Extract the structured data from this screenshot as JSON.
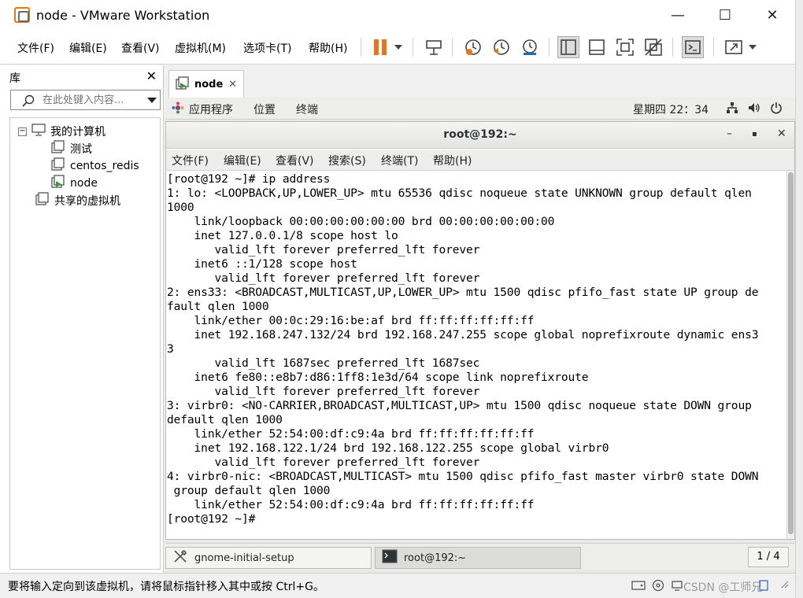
{
  "window": {
    "title": "node - VMware Workstation",
    "minimize": "—",
    "maximize": "☐",
    "close": "✕"
  },
  "host_menu": [
    {
      "label": "文件(F)"
    },
    {
      "label": "编辑(E)"
    },
    {
      "label": "查看(V)"
    },
    {
      "label": "虚拟机(M)"
    },
    {
      "label": "选项卡(T)"
    },
    {
      "label": "帮助(H)"
    }
  ],
  "toolbar_icons": [
    "pause-icon",
    "dropdown-icon",
    "send-ctrl-alt-del-icon",
    "snapshot-icon",
    "revert-snapshot-icon",
    "snapshot-manager-icon",
    "library-view-icon",
    "thumbnail-view-icon",
    "fullscreen-icon",
    "unity-icon",
    "console-view-icon",
    "stretch-icon"
  ],
  "library": {
    "title": "库",
    "close": "✕",
    "search_placeholder": "在此处键入内容...",
    "tree": {
      "my_computer": "我的计算机",
      "vms": [
        "测试",
        "centos_redis",
        "node"
      ],
      "shared": "共享的虚拟机",
      "collapse": "−"
    }
  },
  "tab": {
    "label": "node",
    "close": "✕"
  },
  "gnome_bar": {
    "applications": "应用程序",
    "places": "位置",
    "terminal": "终端",
    "clock": "星期四 22：34"
  },
  "terminal": {
    "title": "root@192:~",
    "ctrl_min": "–",
    "ctrl_max": "▪",
    "ctrl_close": "✕",
    "menu": [
      "文件(F)",
      "编辑(E)",
      "查看(V)",
      "搜索(S)",
      "终端(T)",
      "帮助(H)"
    ],
    "lines": [
      "[root@192 ~]# ip address",
      "1: lo: <LOOPBACK,UP,LOWER_UP> mtu 65536 qdisc noqueue state UNKNOWN group default qlen",
      "1000",
      "    link/loopback 00:00:00:00:00:00 brd 00:00:00:00:00:00",
      "    inet 127.0.0.1/8 scope host lo",
      "       valid_lft forever preferred_lft forever",
      "    inet6 ::1/128 scope host",
      "       valid_lft forever preferred_lft forever",
      "2: ens33: <BROADCAST,MULTICAST,UP,LOWER_UP> mtu 1500 qdisc pfifo_fast state UP group de",
      "fault qlen 1000",
      "    link/ether 00:0c:29:16:be:af brd ff:ff:ff:ff:ff:ff",
      "    inet 192.168.247.132/24 brd 192.168.247.255 scope global noprefixroute dynamic ens3",
      "3",
      "       valid_lft 1687sec preferred_lft 1687sec",
      "    inet6 fe80::e8b7:d86:1ff8:1e3d/64 scope link noprefixroute",
      "       valid_lft forever preferred_lft forever",
      "3: virbr0: <NO-CARRIER,BROADCAST,MULTICAST,UP> mtu 1500 qdisc noqueue state DOWN group",
      "default qlen 1000",
      "    link/ether 52:54:00:df:c9:4a brd ff:ff:ff:ff:ff:ff",
      "    inet 192.168.122.1/24 brd 192.168.122.255 scope global virbr0",
      "       valid_lft forever preferred_lft forever",
      "4: virbr0-nic: <BROADCAST,MULTICAST> mtu 1500 qdisc pfifo_fast master virbr0 state DOWN",
      " group default qlen 1000",
      "    link/ether 52:54:00:df:c9:4a brd ff:ff:ff:ff:ff:ff",
      "[root@192 ~]# "
    ]
  },
  "taskbar": {
    "items": [
      "gnome-initial-setup",
      "root@192:~"
    ],
    "workspace": "1 / 4"
  },
  "status": {
    "text": "要将输入定向到该虚拟机，请将鼠标指针移入其中或按 Ctrl+G。",
    "watermark": "CSDN @工师兄"
  },
  "colors": {
    "accent_orange": "#e8731a",
    "vm_green": "#3a9a3a"
  }
}
